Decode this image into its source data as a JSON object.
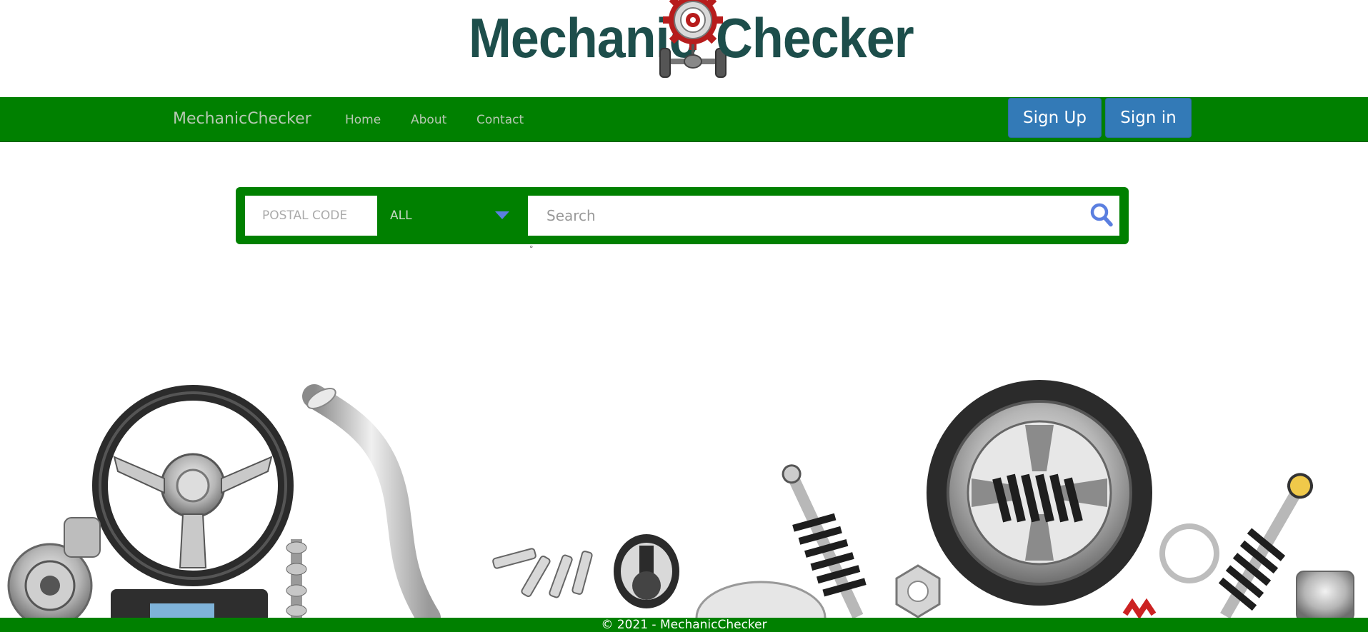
{
  "logo": {
    "left_text": "Mechanic",
    "right_text": "Checker",
    "icon": "gear-axle-icon"
  },
  "navbar": {
    "brand": "MechanicChecker",
    "links": [
      "Home",
      "About",
      "Contact"
    ],
    "signup_label": "Sign Up",
    "signin_label": "Sign in",
    "background": "#008000",
    "button_color": "#337ab7"
  },
  "search": {
    "postal_placeholder": "POSTAL CODE",
    "category_value": "ALL",
    "search_placeholder": "Search",
    "icon": "search-icon",
    "accent": "#5b7fe0",
    "degree_mark": "°"
  },
  "hero": {
    "image": "car-parts-illustration"
  },
  "footer": {
    "text": "© 2021 - MechanicChecker"
  }
}
